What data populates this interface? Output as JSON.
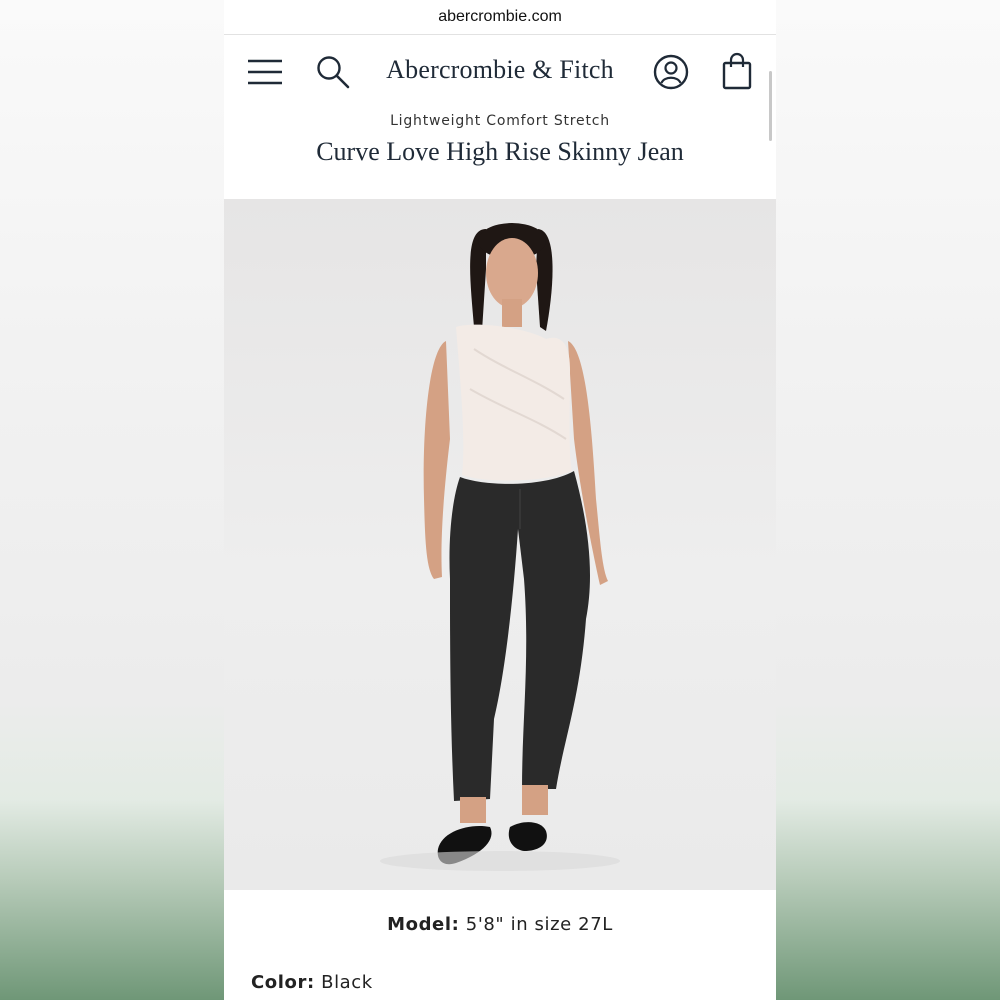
{
  "browser": {
    "url": "abercrombie.com"
  },
  "header": {
    "brand": "Abercrombie & Fitch",
    "icons": [
      "menu-icon",
      "search-icon",
      "account-icon",
      "shopping-bag-icon"
    ]
  },
  "product": {
    "category": "Lightweight Comfort Stretch",
    "title": "Curve Love High Rise Skinny Jean",
    "image": "photo of model wearing the jeans",
    "model_label": "Model:",
    "model_value": "5'8\" in size 27L",
    "color_label": "Color:",
    "color_value": "Black"
  },
  "colors": {
    "brand_text": "#1f2a37",
    "background_green": "#6f9777"
  }
}
